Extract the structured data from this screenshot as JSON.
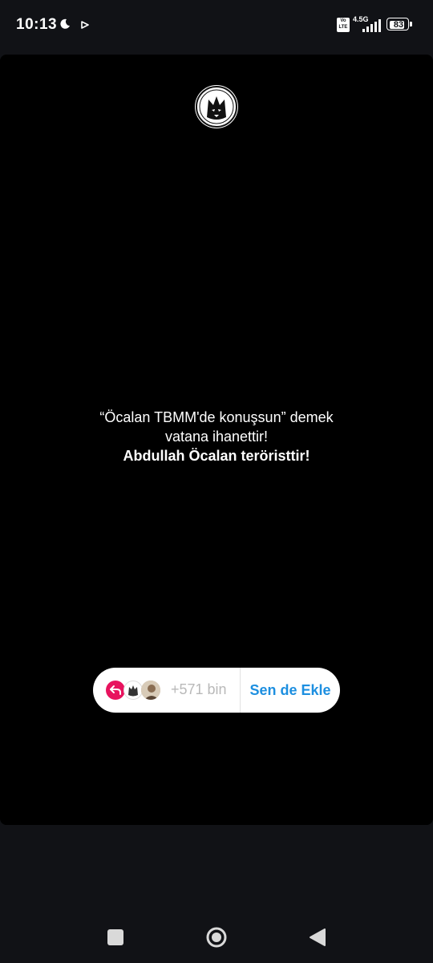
{
  "status_bar": {
    "time": "10:13",
    "network": "4.5G",
    "volte_label": "Vo LTE",
    "battery_text": "83",
    "battery_level": 0.83
  },
  "story": {
    "text_line1": "“Öcalan TBMM'de konuşsun” demek",
    "text_line2": "vatana ihanettir!",
    "text_line3": "Abdullah Öcalan teröristtir!",
    "reaction_count": "+571 bin",
    "add_button_label": "Sen de Ekle",
    "accent_color": "#1d8fe0",
    "reaction_color": "#e8135e"
  },
  "icons": {
    "moon": "moon-icon",
    "play": "play-icon",
    "signal": "signal-icon",
    "battery": "battery-icon",
    "avatar": "wolf-logo-icon",
    "reply": "reply-arrow-icon",
    "nav_recent": "square-icon",
    "nav_home": "circle-icon",
    "nav_back": "triangle-back-icon"
  }
}
